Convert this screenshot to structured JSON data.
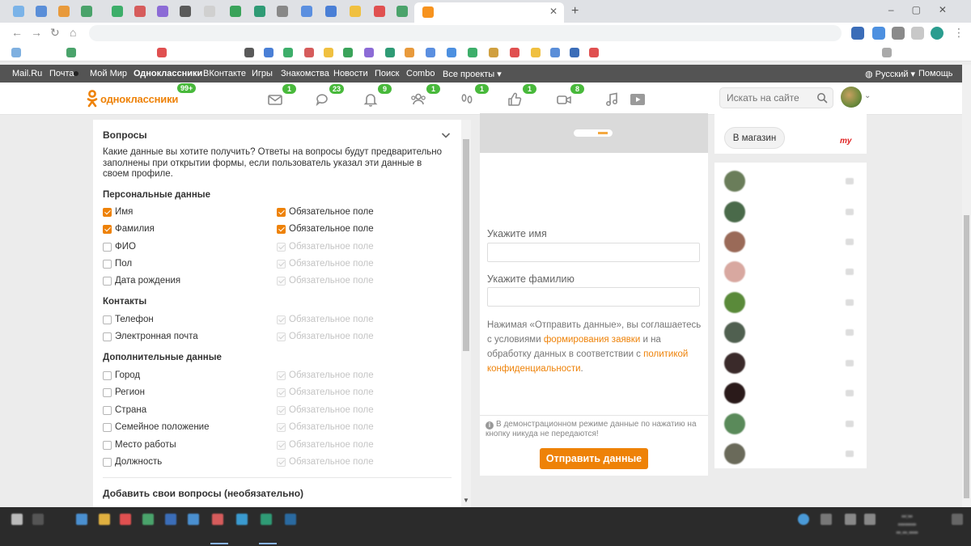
{
  "portal": {
    "links": [
      "Mail.Ru",
      "Почта",
      "Мой Мир",
      "Одноклассники",
      "ВКонтакте",
      "Игры",
      "Знакомства",
      "Новости",
      "Поиск",
      "Combo",
      "Все проекты ▾"
    ],
    "language": "Русский ▾",
    "help": "Помощь"
  },
  "ok_header": {
    "logo_text": "одноклассники",
    "logo_badge": "99+",
    "badges": {
      "messages": "1",
      "discussions": "23",
      "notifications": "9",
      "friends": "1",
      "guests": "1",
      "events": "1",
      "video": "8"
    },
    "search_placeholder": "Искать на сайте"
  },
  "questions": {
    "title": "Вопросы",
    "description": "Какие данные вы хотите получить? Ответы на вопросы будут предварительно заполнены при открытии формы, если пользователь указал эти данные в своем профиле.",
    "required_label": "Обязательное поле",
    "sections": [
      {
        "title": "Персональные данные",
        "items": [
          {
            "label": "Имя",
            "checked": true,
            "required": true
          },
          {
            "label": "Фамилия",
            "checked": true,
            "required": true
          },
          {
            "label": "ФИО",
            "checked": false,
            "required": false
          },
          {
            "label": "Пол",
            "checked": false,
            "required": false
          },
          {
            "label": "Дата рождения",
            "checked": false,
            "required": false
          }
        ]
      },
      {
        "title": "Контакты",
        "items": [
          {
            "label": "Телефон",
            "checked": false,
            "required": false
          },
          {
            "label": "Электронная почта",
            "checked": false,
            "required": false
          }
        ]
      },
      {
        "title": "Дополнительные данные",
        "items": [
          {
            "label": "Город",
            "checked": false,
            "required": false
          },
          {
            "label": "Регион",
            "checked": false,
            "required": false
          },
          {
            "label": "Страна",
            "checked": false,
            "required": false
          },
          {
            "label": "Семейное положение",
            "checked": false,
            "required": false
          },
          {
            "label": "Место работы",
            "checked": false,
            "required": false
          },
          {
            "label": "Должность",
            "checked": false,
            "required": false
          }
        ]
      }
    ],
    "add_questions": "Добавить свои вопросы (необязательно)"
  },
  "form_preview": {
    "name_label": "Укажите имя",
    "surname_label": "Укажите фамилию",
    "consent_1": "Нажимая «Отправить данные», вы соглашаетесь с условиями ",
    "consent_link_1": "формирования заявки",
    "consent_2": " и на обработку данных в соответствии с ",
    "consent_link_2": "политикой конфиденциальности",
    "consent_3": ".",
    "demo_note": "В демонстрационном режиме данные по нажатию на кнопку никуда не передаются!",
    "submit": "Отправить данные"
  },
  "sidebar": {
    "shop_button": "В магазин",
    "shop_logo": "my"
  },
  "colors": {
    "accent": "#ee8208",
    "badge": "#48b93b",
    "portal_bar": "#545454"
  }
}
